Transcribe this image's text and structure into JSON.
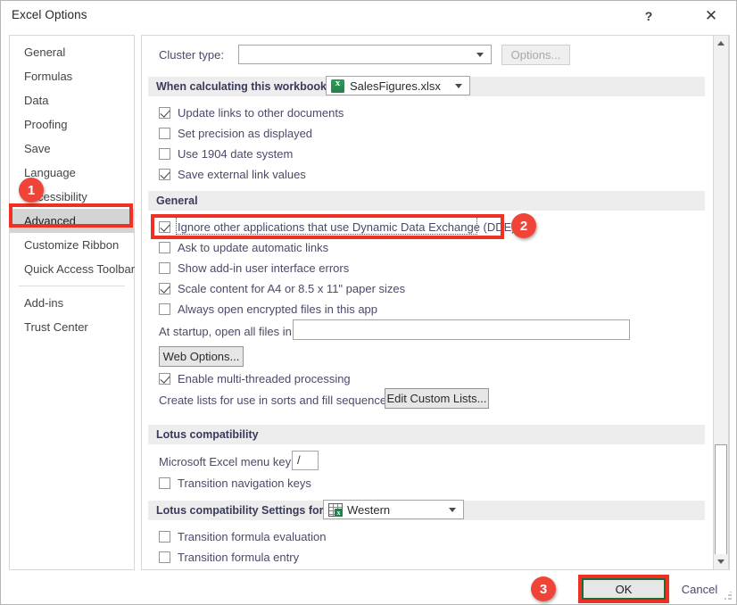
{
  "window": {
    "title": "Excel Options",
    "help_icon": "?",
    "close_icon": "✕"
  },
  "sidebar": {
    "items": [
      {
        "label": "General",
        "selected": false
      },
      {
        "label": "Formulas",
        "selected": false
      },
      {
        "label": "Data",
        "selected": false
      },
      {
        "label": "Proofing",
        "selected": false
      },
      {
        "label": "Save",
        "selected": false
      },
      {
        "label": "Language",
        "selected": false
      },
      {
        "label": "Accessibility",
        "selected": false
      },
      {
        "label": "Advanced",
        "selected": true
      },
      {
        "label": "Customize Ribbon",
        "selected": false
      },
      {
        "label": "Quick Access Toolbar",
        "selected": false
      },
      {
        "label": "Add-ins",
        "selected": false
      },
      {
        "label": "Trust Center",
        "selected": false
      }
    ]
  },
  "content": {
    "cluster_row": {
      "label": "Cluster type:",
      "value": "",
      "options_button": "Options...",
      "options_disabled": true
    },
    "calc_section": {
      "header": "When calculating this workbook:",
      "workbook": "SalesFigures.xlsx",
      "workbook_icon": "excel-file-icon",
      "checkboxes": [
        {
          "label": "Update links to other documents",
          "checked": true
        },
        {
          "label": "Set precision as displayed",
          "checked": false
        },
        {
          "label": "Use 1904 date system",
          "checked": false
        },
        {
          "label": "Save external link values",
          "checked": true
        }
      ]
    },
    "general_section": {
      "header": "General",
      "checkboxes": [
        {
          "label": "Ignore other applications that use Dynamic Data Exchange (DDE)",
          "checked": true,
          "focused": true
        },
        {
          "label": "Ask to update automatic links",
          "checked": false
        },
        {
          "label": "Show add-in user interface errors",
          "checked": false
        },
        {
          "label": "Scale content for A4 or 8.5 x 11\" paper sizes",
          "checked": true
        },
        {
          "label": "Always open encrypted files in this app",
          "checked": false
        }
      ],
      "startup_label": "At startup, open all files in:",
      "startup_value": "",
      "web_options_button": "Web Options...",
      "multithread": {
        "label": "Enable multi-threaded processing",
        "checked": true
      },
      "custom_lists_label": "Create lists for use in sorts and fill sequences:",
      "custom_lists_button": "Edit Custom Lists..."
    },
    "lotus_section": {
      "header": "Lotus compatibility",
      "menu_key_label": "Microsoft Excel menu key:",
      "menu_key_value": "/",
      "transition_nav": {
        "label": "Transition navigation keys",
        "checked": false
      }
    },
    "lotus_settings_section": {
      "header": "Lotus compatibility Settings for:",
      "scope": "Western",
      "scope_icon": "spreadsheet-grid-icon",
      "checkboxes": [
        {
          "label": "Transition formula evaluation",
          "checked": false
        },
        {
          "label": "Transition formula entry",
          "checked": false
        }
      ]
    }
  },
  "scrollbar": {
    "up_arrow": "▲",
    "down_arrow": "▼"
  },
  "footer": {
    "ok_label": "OK",
    "cancel_label": "Cancel"
  },
  "annotations": {
    "badges": [
      {
        "number": "1"
      },
      {
        "number": "2"
      },
      {
        "number": "3"
      }
    ],
    "accent_color": "#f04438",
    "box_color": "#ee3124"
  }
}
